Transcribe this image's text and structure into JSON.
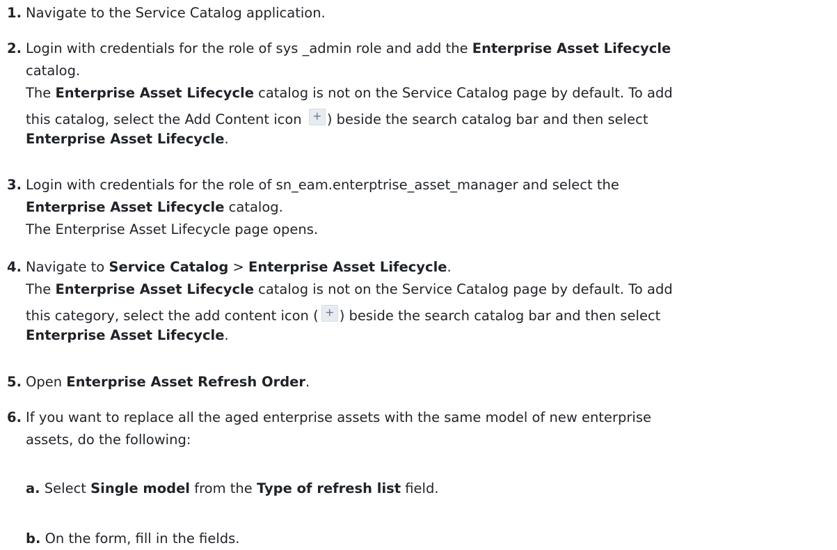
{
  "steps": [
    {
      "num": "1.",
      "text": "Navigate to the Service Catalog application."
    },
    {
      "num": "2.",
      "l1_a": "Login with credentials for the role of sys _admin role and add the ",
      "l1_b": "Enterprise Asset Lifecycle",
      "l2": "catalog.",
      "l3_a": "The ",
      "l3_b": "Enterprise Asset Lifecycle",
      "l3_c": " catalog is not on the Service Catalog page by default. To add",
      "l4_a": "this catalog, select the Add Content icon ",
      "icon": "+",
      "l4_b": ") beside the search catalog bar and then select",
      "l5_a": "Enterprise Asset Lifecycle",
      "l5_b": "."
    },
    {
      "num": "3.",
      "l1": "Login with credentials for the role of sn_eam.enterptrise_asset_manager and select the",
      "l2_a": "Enterprise Asset Lifecycle",
      "l2_b": " catalog.",
      "l3": "The Enterprise Asset Lifecycle page opens."
    },
    {
      "num": "4.",
      "l1_a": "Navigate to ",
      "l1_b": "Service Catalog",
      "l1_c": " > ",
      "l1_d": "Enterprise Asset Lifecycle",
      "l1_e": ".",
      "l2_a": "The ",
      "l2_b": "Enterprise Asset Lifecycle",
      "l2_c": " catalog is not on the Service Catalog page by default. To add",
      "l3_a": "this category, select the add content icon (",
      "icon": "+",
      "l3_b": ") beside the search catalog bar and then select",
      "l4_a": "Enterprise Asset Lifecycle",
      "l4_b": "."
    },
    {
      "num": "5.",
      "l1_a": "Open ",
      "l1_b": "Enterprise Asset Refresh Order",
      "l1_c": "."
    },
    {
      "num": "6.",
      "l1": "If you want to replace all the aged enterprise assets with the same model of new enterprise",
      "l2": "assets, do the following:"
    }
  ],
  "substeps": [
    {
      "num": "a.",
      "t1": " Select ",
      "t2": "Single model",
      "t3": " from the ",
      "t4": "Type of refresh list",
      "t5": " field."
    },
    {
      "num": "b.",
      "t1": " On the form, fill in the fields."
    }
  ]
}
